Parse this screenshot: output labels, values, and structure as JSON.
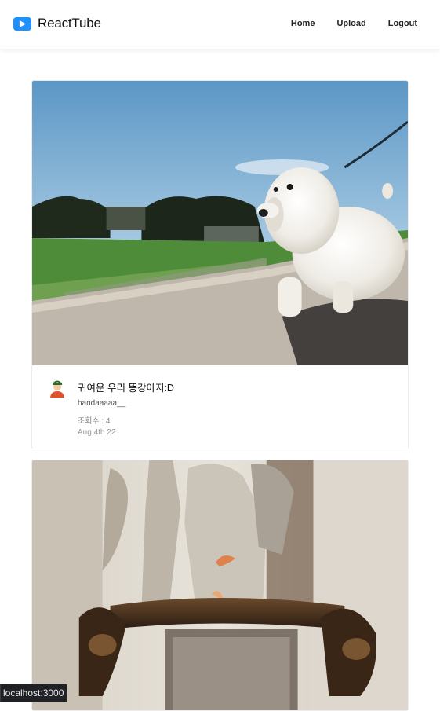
{
  "header": {
    "brand_name": "ReactTube",
    "brand_color": "#1e90ff",
    "nav": [
      "Home",
      "Upload",
      "Logout"
    ]
  },
  "videos": [
    {
      "title": "귀여운 우리 똥강아지:D",
      "author": "handaaaaa__",
      "views": "조회수 : 4",
      "date": "Aug 4th 22",
      "thumbnail": "white fluffy puppy walking on a leash on pavement"
    },
    {
      "thumbnail": "ornate stone statue and bronze brazier with flame"
    }
  ],
  "status_url": "localhost:3000"
}
